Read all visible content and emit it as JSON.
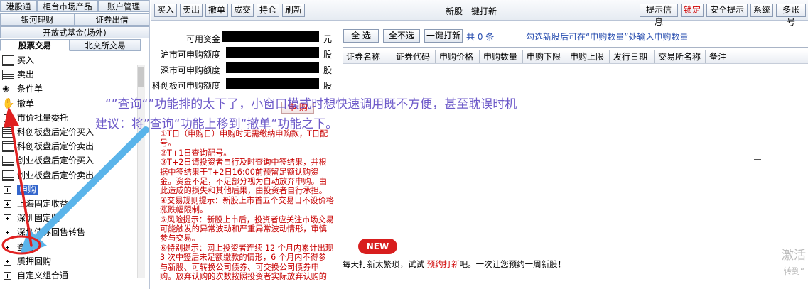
{
  "left_panel": {
    "tabs_row1": [
      "港股通",
      "柜台市场产品",
      "账户管理"
    ],
    "tabs_row2": [
      "银河理财",
      "证券出借"
    ],
    "tabs_row3": [
      "开放式基金(场外)"
    ],
    "tabs_row4": [
      "股票交易",
      "北交所交易"
    ],
    "tree": [
      {
        "label": "买入",
        "icon": "buy-doc-icon"
      },
      {
        "label": "卖出",
        "icon": "sell-doc-icon"
      },
      {
        "label": "条件单",
        "icon": "condition-order-icon"
      },
      {
        "label": "撤单",
        "icon": "hand-cancel-icon"
      },
      {
        "label": "市价批量委托",
        "icon": "expand-plus-icon"
      },
      {
        "label": "科创板盘后定价买入",
        "icon": "doc-icon"
      },
      {
        "label": "科创板盘后定价卖出",
        "icon": "doc-icon"
      },
      {
        "label": "创业板盘后定价买入",
        "icon": "doc-icon"
      },
      {
        "label": "创业板盘后定价卖出",
        "icon": "doc-icon"
      },
      {
        "label": "申购",
        "icon": "expand-plus-icon"
      },
      {
        "label": "上海固定收益",
        "icon": "expand-plus-icon"
      },
      {
        "label": "深圳固定收",
        "icon": "expand-plus-icon"
      },
      {
        "label": "深圳债券回售转售",
        "icon": "expand-plus-icon"
      },
      {
        "label": "查询",
        "icon": "expand-plus-icon"
      },
      {
        "label": "质押回购",
        "icon": "expand-plus-icon"
      },
      {
        "label": "自定义组合通",
        "icon": "expand-plus-icon"
      }
    ]
  },
  "toolbar": {
    "left_buttons": [
      "买入",
      "卖出",
      "撤单",
      "成交",
      "持仓",
      "刷新"
    ],
    "title": "新股一键打新",
    "right_buttons": [
      "提示信息",
      "锁定",
      "安全提示",
      "系统",
      "多账号"
    ]
  },
  "form": {
    "rows": [
      {
        "label": "可用资金",
        "unit": "元"
      },
      {
        "label": "沪市可申购额度",
        "unit": "股"
      },
      {
        "label": "深市可申购额度",
        "unit": "股"
      },
      {
        "label": "科创板可申购额度",
        "unit": "股"
      }
    ],
    "apply_button": "申 购"
  },
  "notice": [
    "①T日（申购日）申购时无需缴纳申购款，T日配号。",
    "②T+1日查询配号。",
    "③T+2日请投资者自行及时查询中签结果，并根据中签结果于T+2日16:00前预留足额认购资金。资金不足，不足部分视为自动放弃申购。由此造成的损失和其他后果，由投资者自行承担。",
    "④交易规则提示：新股上市首五个交易日不设价格涨跌幅限制。",
    "⑤风险提示：新股上市后，投资者应关注市场交易可能触发的异常波动和严重异常波动情形，审慎参与交易。",
    "⑥特别提示：网上投资者连续 12 个月内累计出现 3 次中签后未足额缴款的情形，6 个月内不得参与新股、可转换公司债券、可交换公司债券申购。放弃认购的次数按照投资者实际放弃认购的"
  ],
  "grid": {
    "buttons": [
      "全 选",
      "全不选",
      "一键打新"
    ],
    "selected_count": "共 0 条",
    "hint": "勾选新股后可在“申购数量”处输入申购数量",
    "columns": [
      "证券名称",
      "证券代码",
      "申购价格",
      "申购数量",
      "申购下限",
      "申购上限",
      "发行日期",
      "交易所名称",
      "备注"
    ]
  },
  "promo": {
    "badge": "NEW",
    "text_before": "每天打新太繁琐，试试 ",
    "link": "预约打新",
    "text_after": "吧。一次让您预约一周新股！"
  },
  "watermark": {
    "line1": "激活",
    "line2": "转到“"
  },
  "annotation": {
    "line1": "“”查询“”功能排的太下了，小窗口模式时想快速调用既不方便，甚至耽误时机",
    "line2": "建议：将”查询“功能上移到“撤单“功能之下。"
  },
  "colors": {
    "accent_red": "#d00000",
    "annotation_purple": "#6d5ac9",
    "arrow_blue": "#5ab4ea",
    "arrow_red": "#e02020",
    "selection_blue": "#3366cc"
  }
}
